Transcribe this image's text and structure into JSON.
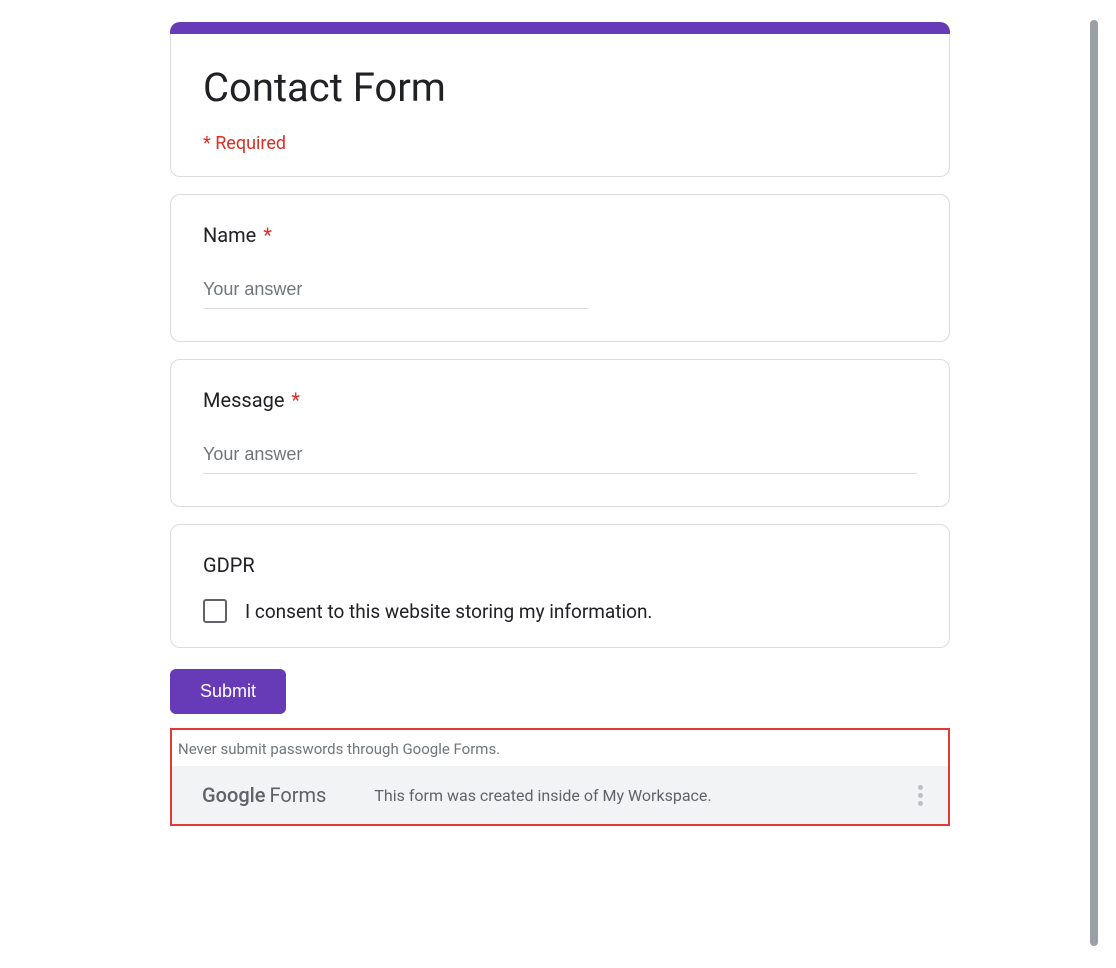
{
  "header": {
    "title": "Contact Form",
    "required_note": "* Required"
  },
  "questions": {
    "name": {
      "label": "Name",
      "required": true,
      "placeholder": "Your answer"
    },
    "message": {
      "label": "Message",
      "required": true,
      "placeholder": "Your answer"
    },
    "gdpr": {
      "label": "GDPR",
      "option": "I consent to this website storing my information."
    }
  },
  "submit_label": "Submit",
  "footer": {
    "warning": "Never submit passwords through Google Forms.",
    "logo_google": "Google",
    "logo_forms": "Forms",
    "created_text": "This form was created inside of My Workspace."
  },
  "asterisk": "*"
}
